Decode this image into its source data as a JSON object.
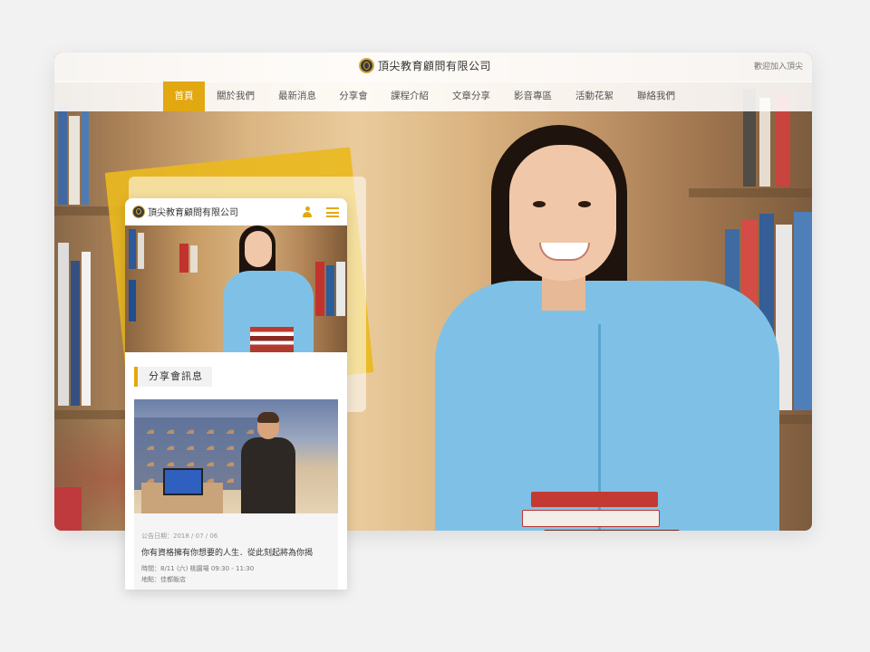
{
  "desktop": {
    "brand_name": "頂尖教育顧問有限公司",
    "join_link": "歡迎加入頂尖",
    "nav": [
      {
        "label": "首頁",
        "active": true
      },
      {
        "label": "關於我們"
      },
      {
        "label": "最新消息"
      },
      {
        "label": "分享會"
      },
      {
        "label": "課程介紹"
      },
      {
        "label": "文章分享"
      },
      {
        "label": "影音專區"
      },
      {
        "label": "活動花絮"
      },
      {
        "label": "聯絡我們"
      }
    ]
  },
  "mobile": {
    "brand_name": "頂尖教育顧問有限公司",
    "section_title": "分享會訊息",
    "news": {
      "date": "公告日期：2018 / 07 / 06",
      "title": "你有資格擁有你想要的人生．從此刻起將為你揭",
      "time": "時間：8/11 (六) 桃園場 09:30 - 11:30",
      "place": "地點：佳都飯店"
    }
  },
  "colors": {
    "accent": "#e2a811",
    "hoodie": "#7fc1e6"
  }
}
